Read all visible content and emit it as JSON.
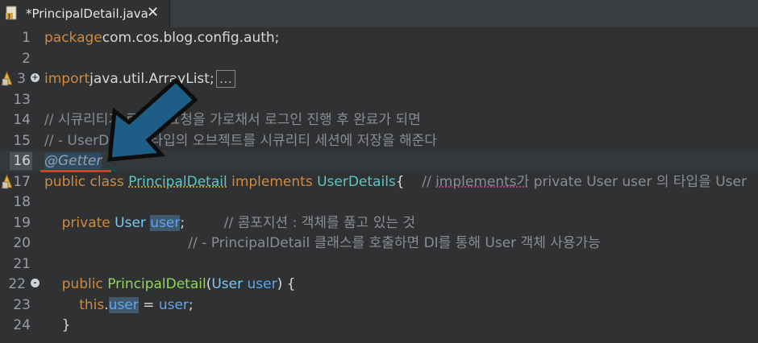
{
  "tab": {
    "title": "*PrincipalDetail.java",
    "close": "✕",
    "icon": "java-file-icon"
  },
  "lines": [
    {
      "num": "1",
      "tokens": [
        [
          "kw",
          "package"
        ],
        [
          "",
          "com.cos.blog.config.auth;"
        ]
      ]
    },
    {
      "num": "2",
      "tokens": []
    },
    {
      "num": "3",
      "tokens": [
        [
          "kw",
          "import"
        ],
        [
          "",
          "java.util.ArrayList;"
        ]
      ],
      "fold": "+",
      "marker": true,
      "folded": "..."
    },
    {
      "num": "13",
      "tokens": []
    },
    {
      "num": "14",
      "tokens": [
        [
          "cmt",
          "// 시큐리티가 로그인 요청을 가로채서 로그인 진행 후 완료가 되면"
        ]
      ]
    },
    {
      "num": "15",
      "tokens": [
        [
          "cmt",
          "// - UserDetails 타입의 오브젝트를 시큐리티 세션에 저장을 해준다"
        ]
      ]
    },
    {
      "num": "16",
      "tokens": [
        [
          "ann",
          "@Getter"
        ]
      ],
      "current": true
    },
    {
      "num": "17",
      "tokens": [
        [
          "kw",
          "public class "
        ],
        [
          "cls underl",
          "PrincipalDetail"
        ],
        [
          "",
          " "
        ],
        [
          "kw",
          "implements "
        ],
        [
          "cls",
          "UserDetails"
        ],
        [
          "",
          "{    "
        ],
        [
          "cmt",
          "// "
        ],
        [
          "cmt underl2",
          "implements가"
        ],
        [
          "cmt",
          " private User user 의 타입을 User"
        ]
      ],
      "marker": true
    },
    {
      "num": "18",
      "tokens": []
    },
    {
      "num": "19",
      "tokens": [
        [
          "",
          "    "
        ],
        [
          "kw",
          "private "
        ],
        [
          "type",
          "User "
        ],
        [
          "fieldhl",
          "user"
        ],
        [
          "",
          ";         "
        ],
        [
          "cmt",
          "// 콤포지션 : 객체를 품고 있는 것"
        ]
      ]
    },
    {
      "num": "20",
      "tokens": [
        [
          "",
          "                                 "
        ],
        [
          "cmt",
          "// - PrincipalDetail 클래스를 호출하면 DI를 통해 User 객체 사용가능"
        ]
      ]
    },
    {
      "num": "21",
      "tokens": []
    },
    {
      "num": "22",
      "tokens": [
        [
          "",
          "    "
        ],
        [
          "kw",
          "public "
        ],
        [
          "method",
          "PrincipalDetail"
        ],
        [
          "",
          "("
        ],
        [
          "type",
          "User "
        ],
        [
          "field",
          "user"
        ],
        [
          "",
          ") {"
        ]
      ],
      "fold": "-"
    },
    {
      "num": "23",
      "tokens": [
        [
          "",
          "        "
        ],
        [
          "kw",
          "this"
        ],
        [
          "",
          "."
        ],
        [
          "fieldhl",
          "user"
        ],
        [
          "",
          " = "
        ],
        [
          "field",
          "user"
        ],
        [
          "",
          ";"
        ]
      ]
    },
    {
      "num": "24",
      "tokens": [
        [
          "",
          "    }"
        ]
      ]
    }
  ],
  "colors": {
    "background": "#2f3133",
    "keyword": "#d18a3f",
    "comment": "#8a8e92",
    "class": "#5bc7c3",
    "field": "#5fa6ee",
    "method": "#8ed85a",
    "arrow": "#1d5d86",
    "underline": "#e0332c"
  },
  "overlay": {
    "arrow_icon": "pointing-arrow-icon",
    "underline": "red-underline"
  }
}
